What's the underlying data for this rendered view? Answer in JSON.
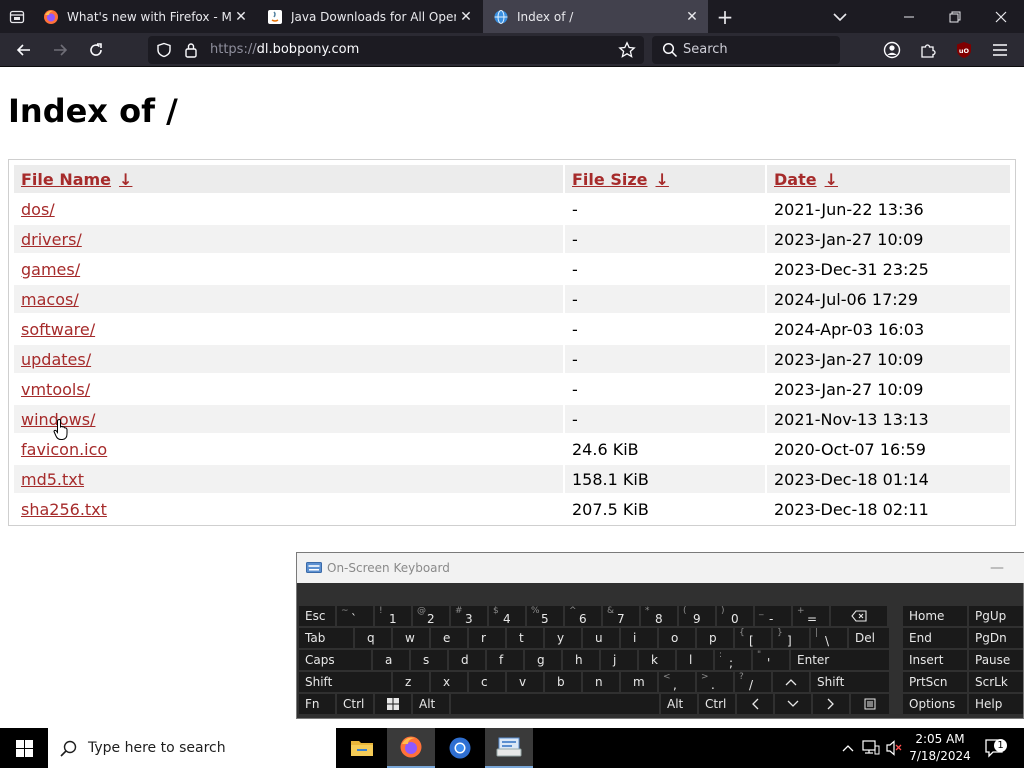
{
  "browser": {
    "tabs": [
      {
        "title": "What's new with Firefox - More privacy, less",
        "active": false,
        "icon": "firefox-icon"
      },
      {
        "title": "Java Downloads for All Operating Systems",
        "active": false,
        "icon": "java-icon"
      },
      {
        "title": "Index of /",
        "active": true,
        "icon": "page-globe-icon"
      }
    ],
    "url_scheme": "https://",
    "url_host": "dl.bobpony.com",
    "search_placeholder": "Search",
    "colors": {
      "tabbar": "#1c1b22",
      "toolbar": "#2b2a33",
      "active_tab": "#42414d",
      "ublock": "#800000"
    }
  },
  "page": {
    "title": "Index of /",
    "columns": [
      {
        "label": "File Name",
        "sort": "↓"
      },
      {
        "label": "File Size",
        "sort": "↓"
      },
      {
        "label": "Date",
        "sort": "↓"
      }
    ],
    "rows": [
      {
        "name": "dos/",
        "size": "-",
        "date": "2021-Jun-22 13:36"
      },
      {
        "name": "drivers/",
        "size": "-",
        "date": "2023-Jan-27 10:09"
      },
      {
        "name": "games/",
        "size": "-",
        "date": "2023-Dec-31 23:25"
      },
      {
        "name": "macos/",
        "size": "-",
        "date": "2024-Jul-06 17:29"
      },
      {
        "name": "software/",
        "size": "-",
        "date": "2024-Apr-03 16:03"
      },
      {
        "name": "updates/",
        "size": "-",
        "date": "2023-Jan-27 10:09"
      },
      {
        "name": "vmtools/",
        "size": "-",
        "date": "2023-Jan-27 10:09"
      },
      {
        "name": "windows/",
        "size": "-",
        "date": "2021-Nov-13 13:13"
      },
      {
        "name": "favicon.ico",
        "size": "24.6 KiB",
        "date": "2020-Oct-07 16:59"
      },
      {
        "name": "md5.txt",
        "size": "158.1 KiB",
        "date": "2023-Dec-18 01:14"
      },
      {
        "name": "sha256.txt",
        "size": "207.5 KiB",
        "date": "2023-Dec-18 02:11"
      }
    ],
    "link_color": "#a62b2b"
  },
  "osk": {
    "title": "On-Screen Keyboard",
    "minimize": "—",
    "keys": {
      "esc": "Esc",
      "tab": "Tab",
      "caps": "Caps",
      "shift": "Shift",
      "shift_right": "Shift",
      "fn": "Fn",
      "ctrl": "Ctrl",
      "alt": "Alt",
      "alt_right": "Alt",
      "ctrl_right": "Ctrl",
      "del": "Del",
      "enter": "Enter",
      "home": "Home",
      "pgup": "PgUp",
      "end": "End",
      "pgdn": "PgDn",
      "insert": "Insert",
      "pause": "Pause",
      "prtscn": "PrtScn",
      "scrlk": "ScrLk",
      "options": "Options",
      "help": "Help",
      "row1": [
        [
          "~",
          "`"
        ],
        [
          "!",
          "1"
        ],
        [
          "@",
          "2"
        ],
        [
          "#",
          "3"
        ],
        [
          "$",
          "4"
        ],
        [
          "%",
          "5"
        ],
        [
          "^",
          "6"
        ],
        [
          "&",
          "7"
        ],
        [
          "*",
          "8"
        ],
        [
          "(",
          "9"
        ],
        [
          ")",
          "0"
        ],
        [
          "_",
          "-"
        ],
        [
          "+",
          "="
        ]
      ],
      "row2": [
        "q",
        "w",
        "e",
        "r",
        "t",
        "y",
        "u",
        "i",
        "o",
        "p",
        [
          "{",
          "["
        ],
        [
          "}",
          "]"
        ],
        [
          "|",
          "\\"
        ]
      ],
      "row3": [
        "a",
        "s",
        "d",
        "f",
        "g",
        "h",
        "j",
        "k",
        "l",
        [
          ":",
          ";"
        ],
        [
          "\"",
          "'"
        ]
      ],
      "row4": [
        "z",
        "x",
        "c",
        "v",
        "b",
        "n",
        "m",
        [
          "<",
          ","
        ],
        [
          ">",
          "."
        ],
        [
          "?",
          "/"
        ]
      ]
    }
  },
  "taskbar": {
    "search_placeholder": "Type here to search",
    "time": "2:05 AM",
    "date": "7/18/2024",
    "notification_count": "1"
  }
}
